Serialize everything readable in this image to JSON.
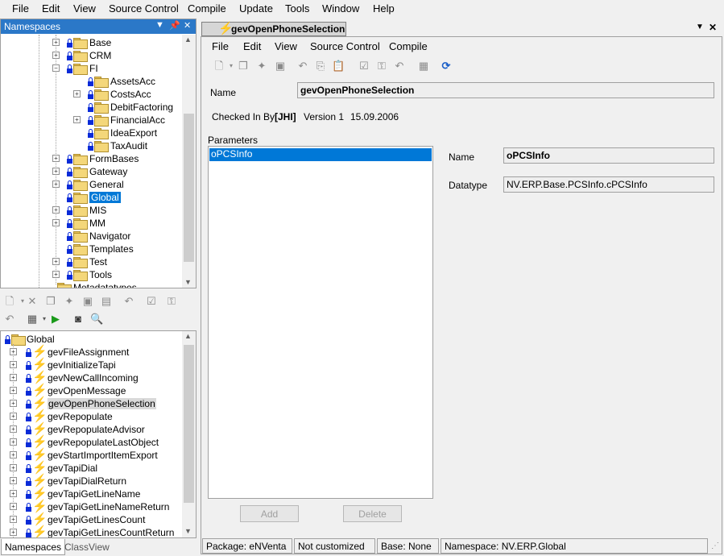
{
  "main_menu": [
    "File",
    "Edit",
    "View",
    "Source Control",
    "Compile",
    "Update",
    "Tools",
    "Window",
    "Help"
  ],
  "namespaces_panel": {
    "title": "Namespaces",
    "items": [
      {
        "label": "Base",
        "level": 3,
        "expander": "+"
      },
      {
        "label": "CRM",
        "level": 3,
        "expander": "+"
      },
      {
        "label": "FI",
        "level": 3,
        "expander": "-"
      },
      {
        "label": "AssetsAcc",
        "level": 4,
        "expander": ""
      },
      {
        "label": "CostsAcc",
        "level": 4,
        "expander": "+"
      },
      {
        "label": "DebitFactoring",
        "level": 4,
        "expander": ""
      },
      {
        "label": "FinancialAcc",
        "level": 4,
        "expander": "+"
      },
      {
        "label": "IdeaExport",
        "level": 4,
        "expander": ""
      },
      {
        "label": "TaxAudit",
        "level": 4,
        "expander": ""
      },
      {
        "label": "FormBases",
        "level": 3,
        "expander": "+"
      },
      {
        "label": "Gateway",
        "level": 3,
        "expander": "+"
      },
      {
        "label": "General",
        "level": 3,
        "expander": "+"
      },
      {
        "label": "Global",
        "level": 3,
        "expander": "",
        "selected": true
      },
      {
        "label": "MIS",
        "level": 3,
        "expander": "+"
      },
      {
        "label": "MM",
        "level": 3,
        "expander": "+"
      },
      {
        "label": "Navigator",
        "level": 3,
        "expander": ""
      },
      {
        "label": "Templates",
        "level": 3,
        "expander": ""
      },
      {
        "label": "Test",
        "level": 3,
        "expander": "+"
      },
      {
        "label": "Tools",
        "level": 3,
        "expander": "+"
      },
      {
        "label": "Metadatatypes",
        "level": 2,
        "expander": ""
      }
    ]
  },
  "global_panel": {
    "root": "Global",
    "items": [
      "gevFileAssignment",
      "gevInitializeTapi",
      "gevNewCallIncoming",
      "gevOpenMessage",
      "gevOpenPhoneSelection",
      "gevRepopulate",
      "gevRepopulateAdvisor",
      "gevRepopulateLastObject",
      "gevStartImportItemExport",
      "gevTapiDial",
      "gevTapiDialReturn",
      "gevTapiGetLineName",
      "gevTapiGetLineNameReturn",
      "gevTapiGetLinesCount",
      "gevTapiGetLinesCountReturn"
    ],
    "selected": "gevOpenPhoneSelection"
  },
  "bottom_tabs": [
    "Namespaces",
    "ClassView"
  ],
  "document": {
    "tab_title": "gevOpenPhoneSelection",
    "menu": [
      "File",
      "Edit",
      "View",
      "Source Control",
      "Compile"
    ],
    "name_label": "Name",
    "name_value": "gevOpenPhoneSelection",
    "checked_in_label": "Checked In By",
    "checked_in_user": "[JHI]",
    "version_text": "Version 1",
    "date_text": "15.09.2006",
    "parameters_label": "Parameters",
    "parameters": [
      "oPCSInfo"
    ],
    "param_name_label": "Name",
    "param_name_value": "oPCSInfo",
    "datatype_label": "Datatype",
    "datatype_value": "NV.ERP.Base.PCSInfo.cPCSInfo",
    "add_button": "Add",
    "delete_button": "Delete"
  },
  "status": {
    "package": "Package: eNVenta",
    "customized": "Not customized",
    "base": "Base: None",
    "namespace": "Namespace: NV.ERP.Global"
  }
}
